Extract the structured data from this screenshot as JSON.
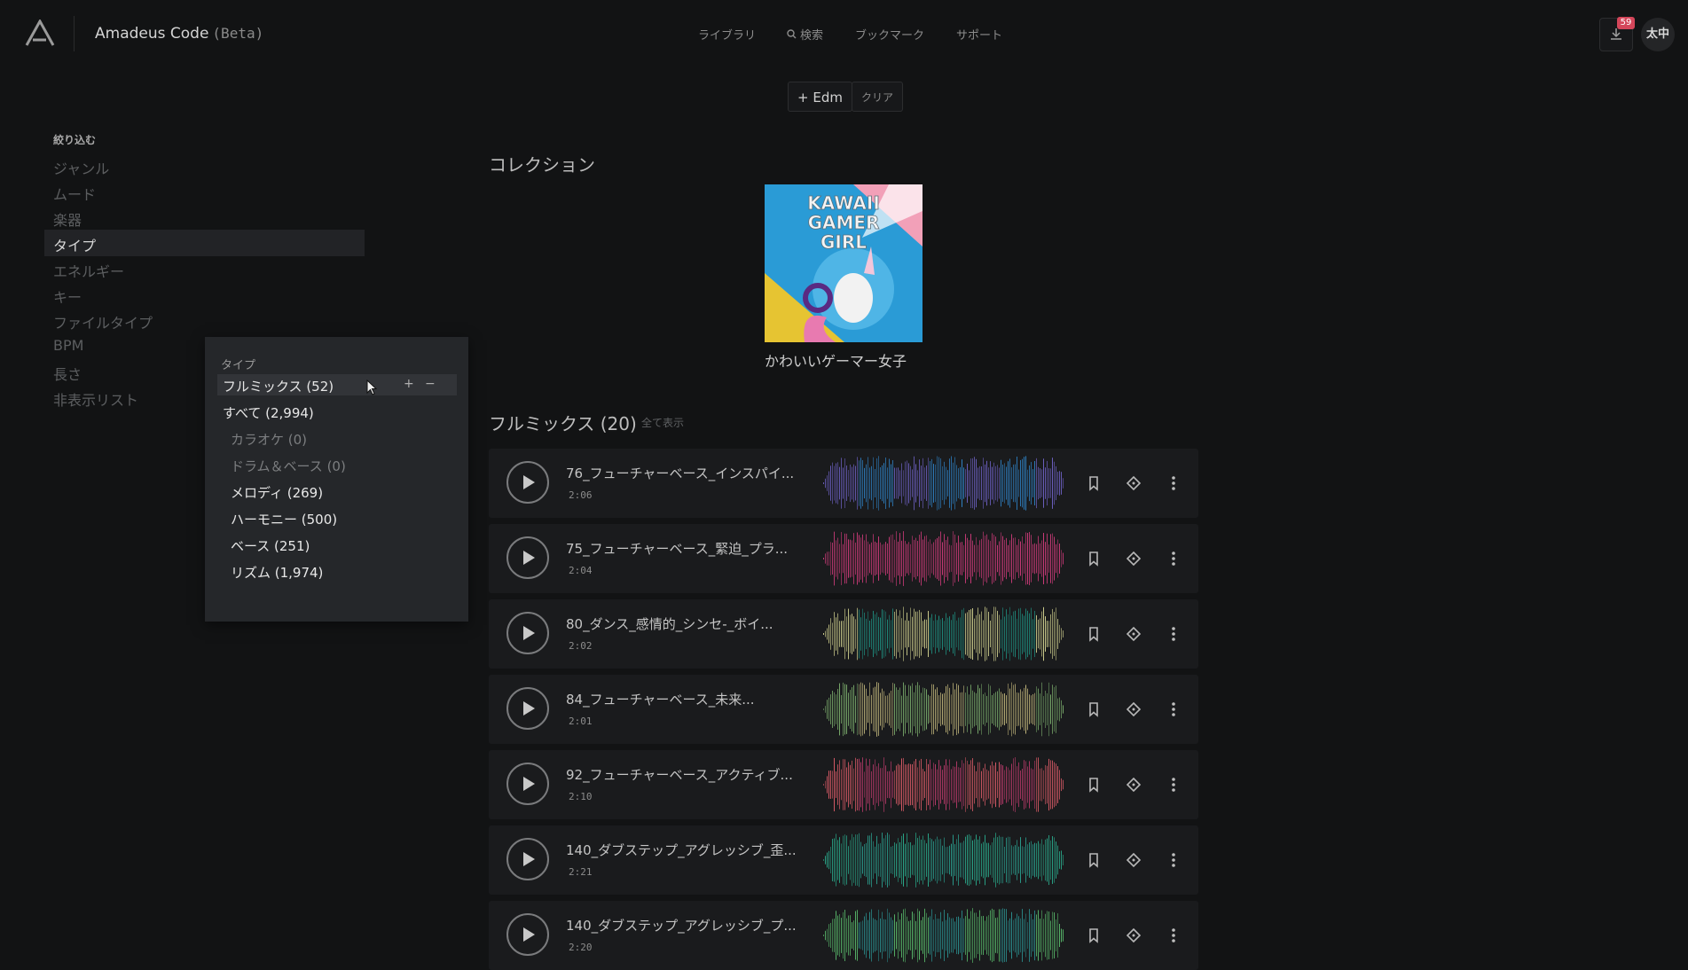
{
  "header": {
    "app_name": "Amadeus Code",
    "beta_label": "(Beta)",
    "nav": [
      {
        "label": "ライブラリ",
        "icon": "none"
      },
      {
        "label": "検索",
        "icon": "search-icon"
      },
      {
        "label": "ブックマーク",
        "icon": "none"
      },
      {
        "label": "サポート",
        "icon": "none"
      }
    ],
    "download_count": "59",
    "avatar_text": "太中"
  },
  "filters": {
    "active_chip": "+ Edm",
    "clear_label": "クリア"
  },
  "sidebar": {
    "heading": "絞り込む",
    "items": [
      {
        "label": "ジャンル"
      },
      {
        "label": "ムード"
      },
      {
        "label": "楽器"
      },
      {
        "label": "タイプ"
      },
      {
        "label": "エネルギー"
      },
      {
        "label": "キー"
      },
      {
        "label": "ファイルタイプ"
      },
      {
        "label": "BPM"
      },
      {
        "label": "長さ"
      },
      {
        "label": "非表示リスト"
      }
    ],
    "selected": "タイプ"
  },
  "type_popup": {
    "title": "タイプ",
    "selected_option": "フルミックス (52)",
    "plus": "+",
    "minus": "−",
    "options": [
      {
        "label": "すべて (2,994)"
      },
      {
        "label": "カラオケ (0)"
      },
      {
        "label": "ドラム＆ベース (0)"
      },
      {
        "label": "メロディ (269)"
      },
      {
        "label": "ハーモニー (500)"
      },
      {
        "label": "ベース (251)"
      },
      {
        "label": "リズム (1,974)"
      }
    ]
  },
  "collection": {
    "heading": "コレクション",
    "card_art_lettering": "KAWAII GAMER GIRL",
    "card_name": "かわいいゲーマー女子"
  },
  "tracks": {
    "heading": "フルミックス (20)",
    "view_all": "全て表示",
    "items": [
      {
        "title": "76_フューチャーベース_インスパイ...",
        "duration": "2:06",
        "colors": [
          "#6b5fbf",
          "#2e7fc1"
        ]
      },
      {
        "title": "75_フューチャーベース_緊迫_プラ...",
        "duration": "2:04",
        "colors": [
          "#c93a77",
          "#c93a77"
        ]
      },
      {
        "title": "80_ダンス_感情的_シンセ-_ボイ...",
        "duration": "2:02",
        "colors": [
          "#c9c98a",
          "#1f8a7c"
        ]
      },
      {
        "title": "84_フューチャーベース_未来...",
        "duration": "2:01",
        "colors": [
          "#78a86a",
          "#bfb47a"
        ]
      },
      {
        "title": "92_フューチャーベース_アクティブ...",
        "duration": "2:10",
        "colors": [
          "#d85a66",
          "#b83a6a"
        ]
      },
      {
        "title": "140_ダブステップ_アグレッシブ_歪...",
        "duration": "2:21",
        "colors": [
          "#2aa88a",
          "#2a9a8a"
        ]
      },
      {
        "title": "140_ダブステップ_アグレッシブ_プ...",
        "duration": "2:20",
        "colors": [
          "#58b86a",
          "#2a8a8a"
        ]
      }
    ]
  }
}
